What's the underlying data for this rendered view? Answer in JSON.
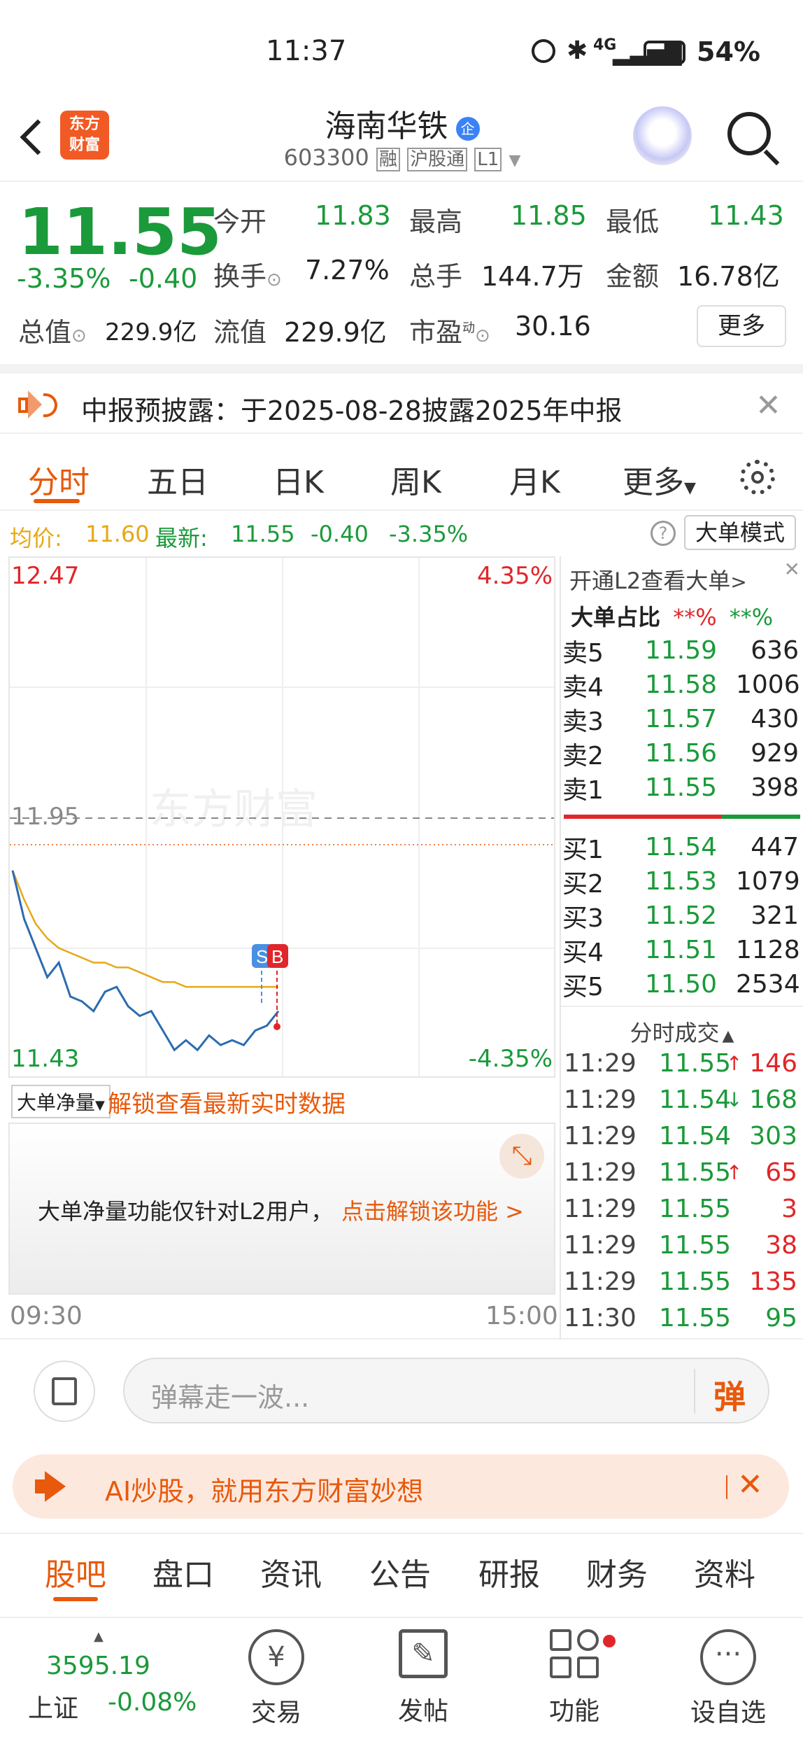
{
  "status_bar": {
    "time": "11:37",
    "network": "4G",
    "battery": "54%"
  },
  "header": {
    "title": "海南华铁",
    "badge": "企",
    "code": "603300",
    "tags": [
      "融",
      "沪股通",
      "L1"
    ],
    "logo_line1": "东方",
    "logo_line2": "财富"
  },
  "quote": {
    "price": "11.55",
    "change_pct": "-3.35%",
    "change": "-0.40",
    "open_label": "今开",
    "open": "11.83",
    "high_label": "最高",
    "high": "11.85",
    "low_label": "最低",
    "low": "11.43",
    "turnover_label": "换手",
    "turnover": "7.27%",
    "volume_label": "总手",
    "volume": "144.7万",
    "amount_label": "金额",
    "amount": "16.78亿",
    "mktcap_label": "总值",
    "mktcap": "229.9亿",
    "float_label": "流值",
    "float": "229.9亿",
    "pe_label": "市盈",
    "pe_sup": "动",
    "pe": "30.16",
    "more_label": "更多"
  },
  "notice": {
    "text": "中报预披露：于2025-08-28披露2025年中报"
  },
  "tabs": [
    "分时",
    "五日",
    "日K",
    "周K",
    "月K",
    "更多"
  ],
  "summary": {
    "avg_label": "均价:",
    "avg": "11.60",
    "latest_label": "最新:",
    "latest": "11.55",
    "change": "-0.40",
    "change_pct": "-3.35%",
    "mode_label": "大单模式",
    "help": "?"
  },
  "chart": {
    "y_max": "12.47",
    "y_min": "11.43",
    "pct_max": "4.35%",
    "pct_min": "-4.35%",
    "prev_close": "11.95",
    "watermark": "东方财富",
    "marker_s": "S",
    "marker_b": "B",
    "time_start": "09:30",
    "time_end": "15:00"
  },
  "chart_data": {
    "type": "line",
    "ylim": [
      11.43,
      12.47
    ],
    "series": [
      {
        "values": [
          11.84,
          11.74,
          11.68,
          11.62,
          11.65,
          11.58,
          11.57,
          11.55,
          11.59,
          11.6,
          11.56,
          11.54,
          11.55,
          11.51,
          11.47,
          11.49,
          11.47,
          11.5,
          11.48,
          11.49,
          11.48,
          11.51,
          11.52,
          11.55
        ]
      },
      {
        "values": [
          11.84,
          11.78,
          11.73,
          11.7,
          11.68,
          11.67,
          11.66,
          11.65,
          11.65,
          11.64,
          11.64,
          11.63,
          11.62,
          11.61,
          11.61,
          11.6,
          11.6,
          11.6,
          11.6,
          11.6,
          11.6,
          11.6,
          11.6,
          11.6
        ]
      }
    ]
  },
  "net_volume": {
    "dropdown": "大单净量",
    "unlock_link": "解锁查看最新实时数据",
    "locked_text": "大单净量功能仅针对L2用户，",
    "locked_link": "点击解锁该功能 >"
  },
  "order_book": {
    "l2_link": "开通L2查看大单",
    "ratio_label": "大单占比",
    "ratio_sell": "**%",
    "ratio_buy": "**%",
    "asks": [
      {
        "label": "卖5",
        "price": "11.59",
        "vol": "636"
      },
      {
        "label": "卖4",
        "price": "11.58",
        "vol": "1006"
      },
      {
        "label": "卖3",
        "price": "11.57",
        "vol": "430"
      },
      {
        "label": "卖2",
        "price": "11.56",
        "vol": "929"
      },
      {
        "label": "卖1",
        "price": "11.55",
        "vol": "398"
      }
    ],
    "bids": [
      {
        "label": "买1",
        "price": "11.54",
        "vol": "447"
      },
      {
        "label": "买2",
        "price": "11.53",
        "vol": "1079"
      },
      {
        "label": "买3",
        "price": "11.52",
        "vol": "321"
      },
      {
        "label": "买4",
        "price": "11.51",
        "vol": "1128"
      },
      {
        "label": "买5",
        "price": "11.50",
        "vol": "2534"
      }
    ],
    "trades_title": "分时成交",
    "trades": [
      {
        "time": "11:29",
        "price": "11.55",
        "arrow": "↑",
        "vol": "146",
        "color": "#e0262a"
      },
      {
        "time": "11:29",
        "price": "11.54",
        "arrow": "↓",
        "vol": "168",
        "color": "#1a9a3a"
      },
      {
        "time": "11:29",
        "price": "11.54",
        "arrow": "",
        "vol": "303",
        "color": "#1a9a3a"
      },
      {
        "time": "11:29",
        "price": "11.55",
        "arrow": "↑",
        "vol": "65",
        "color": "#e0262a"
      },
      {
        "time": "11:29",
        "price": "11.55",
        "arrow": "",
        "vol": "3",
        "color": "#e0262a"
      },
      {
        "time": "11:29",
        "price": "11.55",
        "arrow": "",
        "vol": "38",
        "color": "#e0262a"
      },
      {
        "time": "11:29",
        "price": "11.55",
        "arrow": "",
        "vol": "135",
        "color": "#e0262a"
      },
      {
        "time": "11:30",
        "price": "11.55",
        "arrow": "",
        "vol": "95",
        "color": "#1a9a3a"
      }
    ]
  },
  "comment": {
    "placeholder": "弹幕走一波...",
    "danmu_label": "弹"
  },
  "ad": {
    "text": "AI炒股，就用东方财富妙想"
  },
  "bottom_tabs": [
    "股吧",
    "盘口",
    "资讯",
    "公告",
    "研报",
    "财务",
    "资料"
  ],
  "footer": {
    "index_value": "3595.19",
    "index_name": "上证",
    "index_change": "-0.08%",
    "trade": "交易",
    "post": "发帖",
    "features": "功能",
    "watchlist": "设自选"
  },
  "colors": {
    "up": "#e0262a",
    "down": "#1a9a3a",
    "accent": "#e8590c",
    "price_line": "#2b6cb0",
    "avg_line": "#e6a817"
  }
}
